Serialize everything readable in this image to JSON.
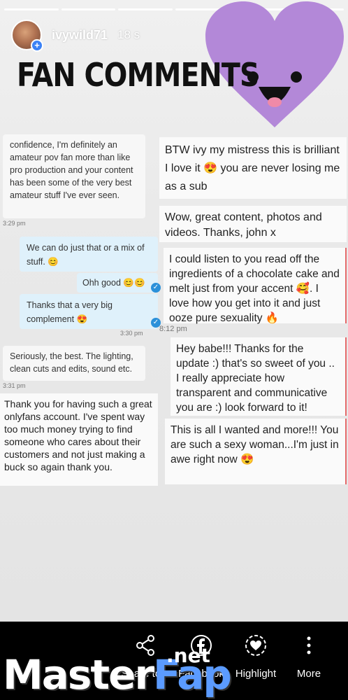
{
  "story": {
    "username": "ivywild71",
    "time_ago": "18 s",
    "title": "FAN COMMENTS"
  },
  "left_messages": [
    {
      "text": "confidence, I'm definitely an amateur pov fan more than like pro production and your content has been some of the very best amateur stuff I've ever seen.",
      "timestamp": "3:29 pm"
    },
    {
      "text": "We can do just that or a mix of stuff. 😊"
    },
    {
      "text": "Ohh good 😊😊"
    },
    {
      "text": "Thanks that a very big complement 😍",
      "timestamp": "3:30 pm"
    },
    {
      "text": "Seriously, the best. The lighting, clean cuts and edits, sound etc.",
      "timestamp": "3:31 pm"
    },
    {
      "text": "Thank you for having such a great onlyfans account. I've spent way too much money trying to find someone who cares about their customers and not just making a buck so again thank you."
    }
  ],
  "right_messages": [
    {
      "text": "BTW ivy my mistress this is brilliant I love it 😍 you are never losing me as a sub"
    },
    {
      "text": "Wow, great content, photos and videos. Thanks, john x"
    },
    {
      "text": "I could listen to you read off the ingredients of a chocolate cake and melt just from your accent 🥰. I love how you get into it and just ooze pure sexuality 🔥",
      "timestamp": "8:12 pm"
    },
    {
      "text": "Hey babe!!! Thanks for the update :) that's so sweet of you .. I really appreciate how transparent and communicative you are :) look forward to it!"
    },
    {
      "text": "This is all I wanted and more!!! You are such a sexy woman...I'm just in awe right now 😍"
    }
  ],
  "actions": {
    "share": "Share to...",
    "facebook": "Facebook",
    "highlight": "Highlight",
    "more": "More"
  },
  "watermark": {
    "master": "Master",
    "fap": "Fap",
    "net": ".net"
  },
  "colors": {
    "heart": "#b388d8",
    "accent_blue": "#2b90d9",
    "blue_bubble": "#dff1fb"
  }
}
